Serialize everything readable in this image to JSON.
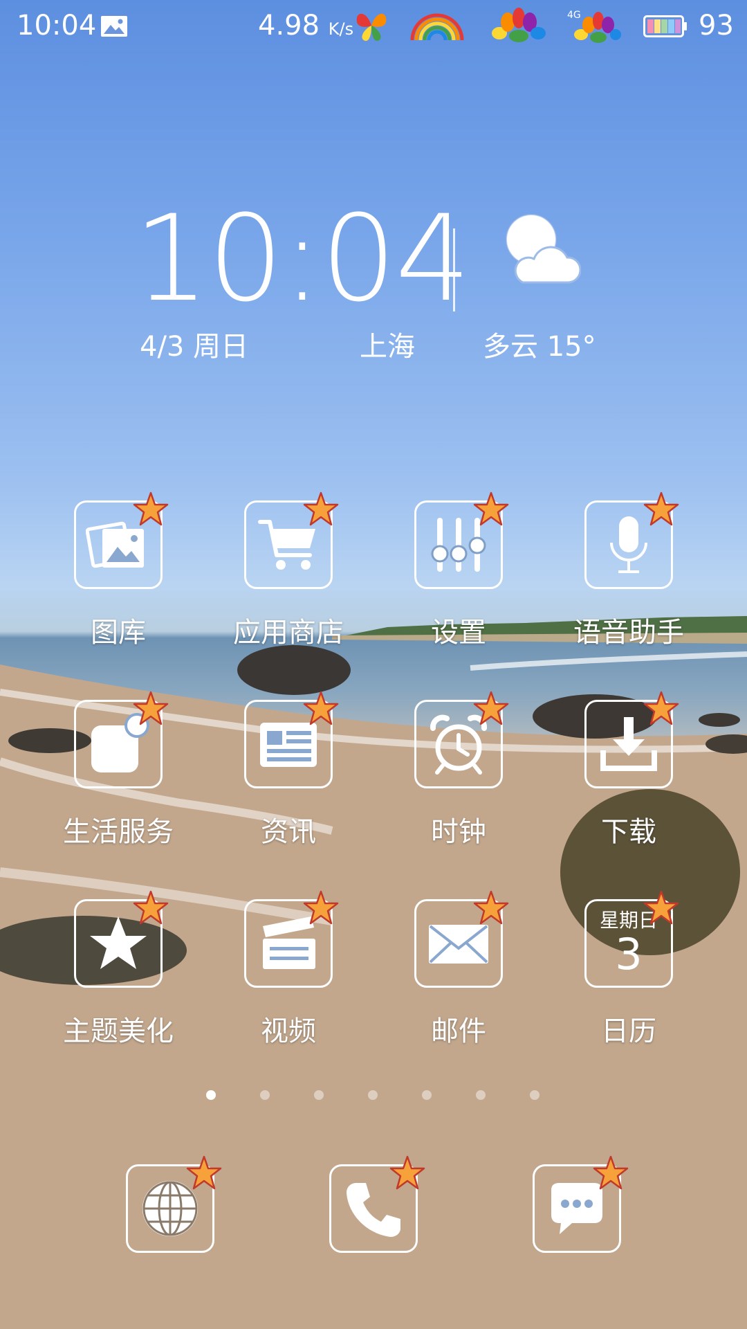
{
  "status_bar": {
    "time": "10:04",
    "net_speed": "4.98",
    "net_unit": "K/s",
    "battery": "93",
    "icons": [
      "image-icon",
      "butterfly-icon",
      "rainbow-icon",
      "peacock-icon",
      "peacock-4g-icon",
      "battery-icon"
    ]
  },
  "clock_widget": {
    "time": "10:04",
    "date": "4/3  周日",
    "city": "上海",
    "weather": "多云 15°",
    "weather_icon": "partly-cloudy-icon"
  },
  "apps": [
    {
      "label": "图库",
      "icon": "gallery-icon"
    },
    {
      "label": "应用商店",
      "icon": "shopping-cart-icon"
    },
    {
      "label": "设置",
      "icon": "sliders-icon"
    },
    {
      "label": "语音助手",
      "icon": "microphone-icon"
    },
    {
      "label": "生活服务",
      "icon": "life-service-icon"
    },
    {
      "label": "资讯",
      "icon": "news-icon"
    },
    {
      "label": "时钟",
      "icon": "alarm-clock-icon"
    },
    {
      "label": "下载",
      "icon": "download-icon"
    },
    {
      "label": "主题美化",
      "icon": "star-icon"
    },
    {
      "label": "视频",
      "icon": "clapperboard-icon"
    },
    {
      "label": "邮件",
      "icon": "mail-icon"
    },
    {
      "label": "日历",
      "icon": "calendar-icon",
      "weekday": "星期日",
      "day": "3"
    }
  ],
  "page_indicator": {
    "count": 7,
    "active_index": 0
  },
  "dock": [
    {
      "name": "browser",
      "icon": "globe-icon"
    },
    {
      "name": "phone",
      "icon": "phone-icon"
    },
    {
      "name": "messages",
      "icon": "chat-bubble-icon"
    }
  ]
}
